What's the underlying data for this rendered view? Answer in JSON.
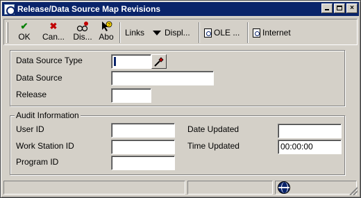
{
  "window": {
    "title": "Release/Data Source Map Revisions",
    "minimize_label": "_",
    "maximize_label": "□",
    "close_label": "×"
  },
  "toolbar": {
    "ok_label": "OK",
    "cancel_label": "Can...",
    "display_label": "Dis...",
    "about_label": "Abo",
    "links_label": "Links",
    "display_menu_label": "Displ...",
    "ole_label": "OLE ...",
    "internet_label": "Internet"
  },
  "form": {
    "data_source_type": {
      "label": "Data Source Type",
      "value": ""
    },
    "data_source": {
      "label": "Data Source",
      "value": ""
    },
    "release": {
      "label": "Release",
      "value": ""
    }
  },
  "audit": {
    "title": "Audit Information",
    "user_id": {
      "label": "User ID",
      "value": ""
    },
    "work_station_id": {
      "label": "Work Station ID",
      "value": ""
    },
    "program_id": {
      "label": "Program ID",
      "value": ""
    },
    "date_updated": {
      "label": "Date Updated",
      "value": ""
    },
    "time_updated": {
      "label": "Time Updated",
      "value": "00:00:00"
    }
  },
  "icons": {
    "ok": "check-icon",
    "cancel": "x-icon",
    "display": "display-icon",
    "about": "about-icon",
    "links": "dropdown-arrow-icon",
    "ole": "document-icon",
    "internet": "document-icon",
    "lookup": "flashlight-icon",
    "status": "globe-icon"
  },
  "colors": {
    "titlebar": "#0a246a",
    "window_bg": "#d4d0c8",
    "ok_check": "#008000",
    "cancel_x": "#c00000"
  }
}
